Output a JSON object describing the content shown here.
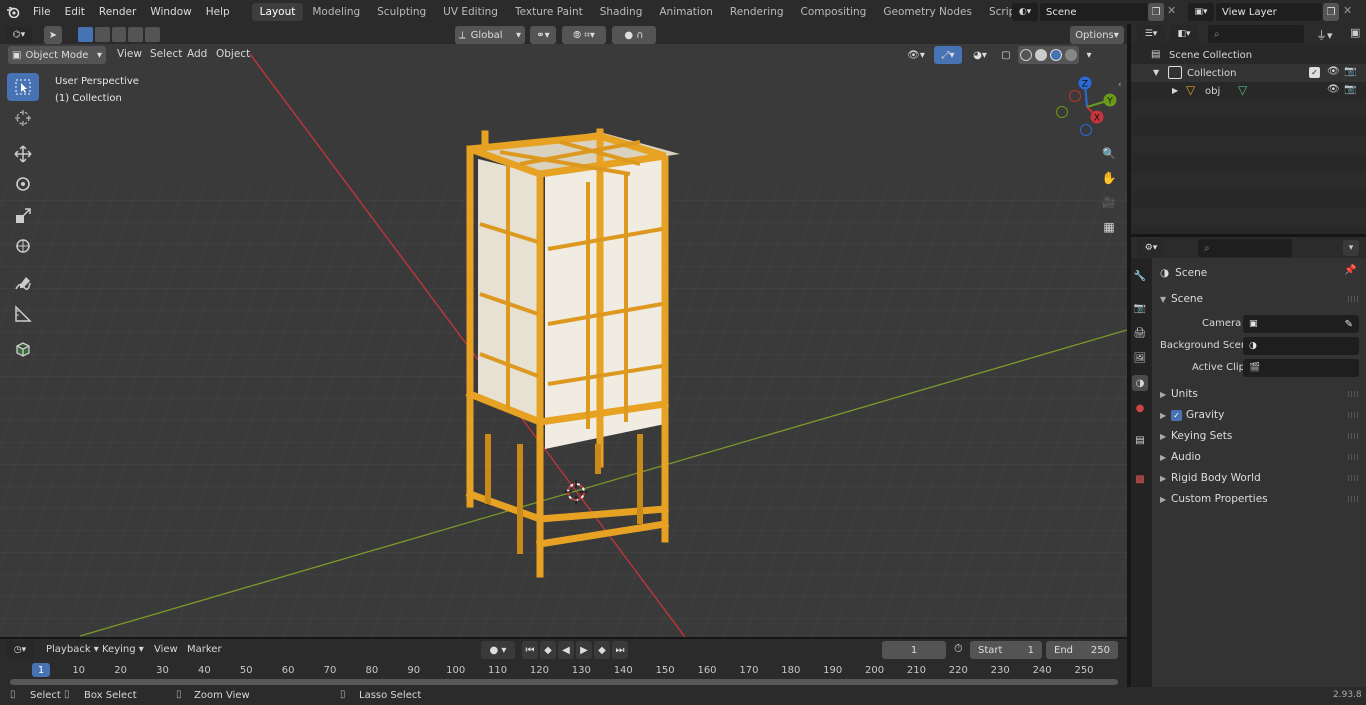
{
  "menus": [
    "File",
    "Edit",
    "Render",
    "Window",
    "Help"
  ],
  "workspaces": [
    "Layout",
    "Modeling",
    "Sculpting",
    "UV Editing",
    "Texture Paint",
    "Shading",
    "Animation",
    "Rendering",
    "Compositing",
    "Geometry Nodes",
    "Scripting"
  ],
  "scene_name": "Scene",
  "view_layer": "View Layer",
  "viewport": {
    "mode": "Object Mode",
    "menu": [
      "View",
      "Select",
      "Add",
      "Object"
    ],
    "transform": "Global",
    "options": "Options",
    "perspective_label": "User Perspective",
    "collection_label": "(1) Collection"
  },
  "gizmo": {
    "z": "Z",
    "y": "Y",
    "x": "X"
  },
  "outliner": {
    "root": "Scene Collection",
    "collection": "Collection",
    "object": "obj"
  },
  "properties": {
    "header": "Scene",
    "section": "Scene",
    "camera_label": "Camera",
    "bg_scene_label": "Background Scene",
    "active_clip_label": "Active Clip",
    "panels": [
      "Units",
      "Gravity",
      "Keying Sets",
      "Audio",
      "Rigid Body World",
      "Custom Properties"
    ]
  },
  "timeline": {
    "menus": [
      "Playback",
      "Keying",
      "View",
      "Marker"
    ],
    "current_frame": "1",
    "start_label": "Start",
    "start": "1",
    "end_label": "End",
    "end": "250",
    "ticks": [
      "1",
      "10",
      "20",
      "30",
      "40",
      "50",
      "60",
      "70",
      "80",
      "90",
      "100",
      "110",
      "120",
      "130",
      "140",
      "150",
      "160",
      "170",
      "180",
      "190",
      "200",
      "210",
      "220",
      "230",
      "240",
      "250"
    ]
  },
  "statusbar": {
    "select": "Select",
    "box_select": "Box Select",
    "zoom_view": "Zoom View",
    "lasso_select": "Lasso Select",
    "version": "2.93.8"
  },
  "colors": {
    "accent": "#4772b3",
    "object": "#e8a020",
    "x_axis": "#c8343a",
    "y_axis": "#7a9a2a"
  }
}
